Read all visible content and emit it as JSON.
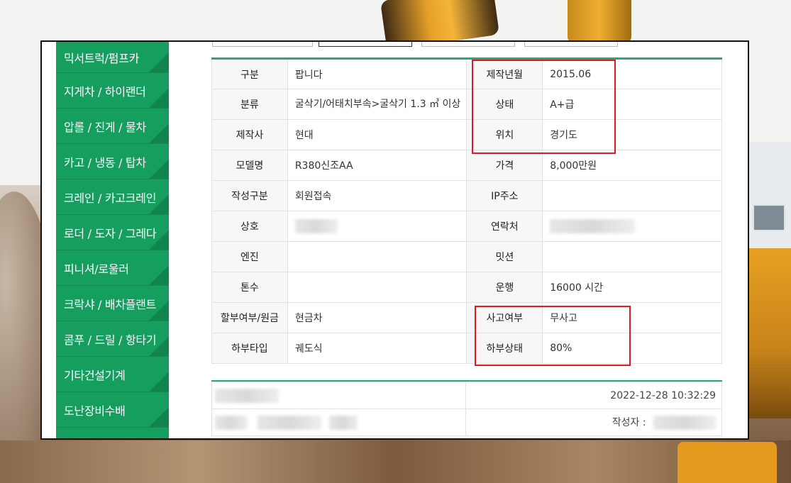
{
  "sidebar": {
    "items": [
      {
        "label": "믹서트럭/펌프카"
      },
      {
        "label": "지게차 / 하이랜더"
      },
      {
        "label": "압롤 / 진게 / 물차"
      },
      {
        "label": "카고 / 냉동 / 탑차"
      },
      {
        "label": "크레인 / 카고크레인"
      },
      {
        "label": "로더 / 도자 / 그레다"
      },
      {
        "label": "피니셔/로울러"
      },
      {
        "label": "크락샤 / 배차플랜트"
      },
      {
        "label": "콤푸 / 드릴 / 항타기"
      },
      {
        "label": "기타건설기계"
      },
      {
        "label": "도난장비수배"
      }
    ]
  },
  "spec": {
    "rows": [
      {
        "l1": "구분",
        "v1": "팝니다",
        "l2": "제작년월",
        "v2": "2015.06"
      },
      {
        "l1": "분류",
        "v1": "굴삭기/어태치부속>굴삭기 1.3 ㎥ 이상",
        "l2": "상태",
        "v2": "A+급"
      },
      {
        "l1": "제작사",
        "v1": "현대",
        "l2": "위치",
        "v2": "경기도"
      },
      {
        "l1": "모델명",
        "v1": "R380신조AA",
        "l2": "가격",
        "v2": "8,000만원"
      },
      {
        "l1": "작성구분",
        "v1": "회원접속",
        "l2": "IP주소",
        "v2": ""
      },
      {
        "l1": "상호",
        "v1": "",
        "l2": "연락처",
        "v2": ""
      },
      {
        "l1": "엔진",
        "v1": "",
        "l2": "밋션",
        "v2": ""
      },
      {
        "l1": "톤수",
        "v1": "",
        "l2": "운행",
        "v2": "16000 시간"
      },
      {
        "l1": "할부여부/원금",
        "v1": "현금차",
        "l2": "사고여부",
        "v2": "무사고"
      },
      {
        "l1": "하부타입",
        "v1": "궤도식",
        "l2": "하부상태",
        "v2": "80%"
      }
    ]
  },
  "meta": {
    "datetime": "2022-12-28 10:32:29",
    "author_label": "작성자 :"
  },
  "colors": {
    "sidebar": "#169e5e",
    "accent_line": "#2aa876",
    "highlight": "#e01b1b"
  }
}
